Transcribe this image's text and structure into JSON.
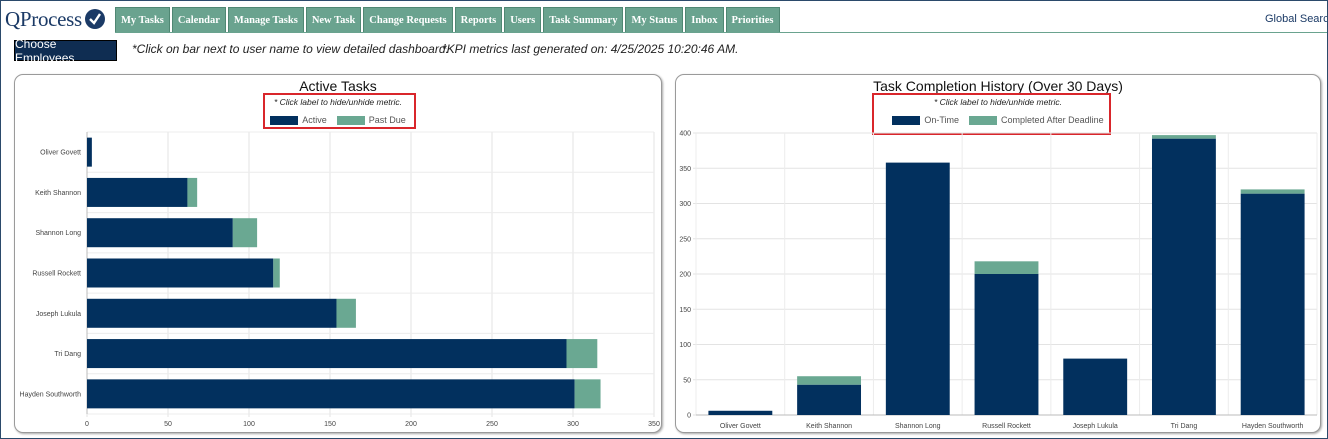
{
  "app": {
    "logo_text": "QProcess",
    "global_search": "Global Search"
  },
  "tabs": [
    "My Tasks",
    "Calendar",
    "Manage Tasks",
    "New Task",
    "Change Requests",
    "Reports",
    "Users",
    "Task Summary",
    "My Status",
    "Inbox",
    "Priorities"
  ],
  "toolbar": {
    "choose_employees": "Choose Employees",
    "click_hint": "*Click on bar next to user name to view detailed dashboard.",
    "kpi_note": "*KPI metrics last generated on: 4/25/2025 10:20:46 AM."
  },
  "colors": {
    "dark": "#02305e",
    "green": "#6aa892",
    "tab": "#6aa38f"
  },
  "chart_data": [
    {
      "type": "bar",
      "orientation": "horizontal",
      "stacked": true,
      "title": "Active Tasks",
      "subtitle": "* Click label to hide/unhide metric.",
      "legend_placement": "top-center",
      "categories": [
        "Oliver Govett",
        "Keith Shannon",
        "Shannon Long",
        "Russell Rockett",
        "Joseph Lukula",
        "Tri Dang",
        "Hayden Southworth"
      ],
      "series": [
        {
          "name": "Active",
          "values": [
            3,
            62,
            90,
            115,
            154,
            296,
            301
          ]
        },
        {
          "name": "Past Due",
          "values": [
            0,
            6,
            15,
            4,
            12,
            19,
            16
          ]
        }
      ],
      "xlim": [
        0,
        350
      ],
      "ticks": [
        0,
        50,
        100,
        150,
        200,
        250,
        300,
        350
      ],
      "grid": true
    },
    {
      "type": "bar",
      "orientation": "vertical",
      "stacked": true,
      "title": "Task Completion History (Over 30 Days)",
      "subtitle": "* Click label to hide/unhide metric.",
      "legend_placement": "top-center",
      "categories": [
        "Oliver Govett",
        "Keith Shannon",
        "Shannon Long",
        "Russell Rockett",
        "Joseph Lukula",
        "Tri Dang",
        "Hayden Southworth"
      ],
      "series": [
        {
          "name": "On-Time",
          "values": [
            6,
            43,
            358,
            200,
            80,
            392,
            314
          ]
        },
        {
          "name": "Completed After Deadline",
          "values": [
            0,
            12,
            0,
            18,
            0,
            5,
            6
          ]
        }
      ],
      "ylim": [
        0,
        400
      ],
      "ticks": [
        0,
        50,
        100,
        150,
        200,
        250,
        300,
        350,
        400
      ],
      "grid": true
    }
  ]
}
